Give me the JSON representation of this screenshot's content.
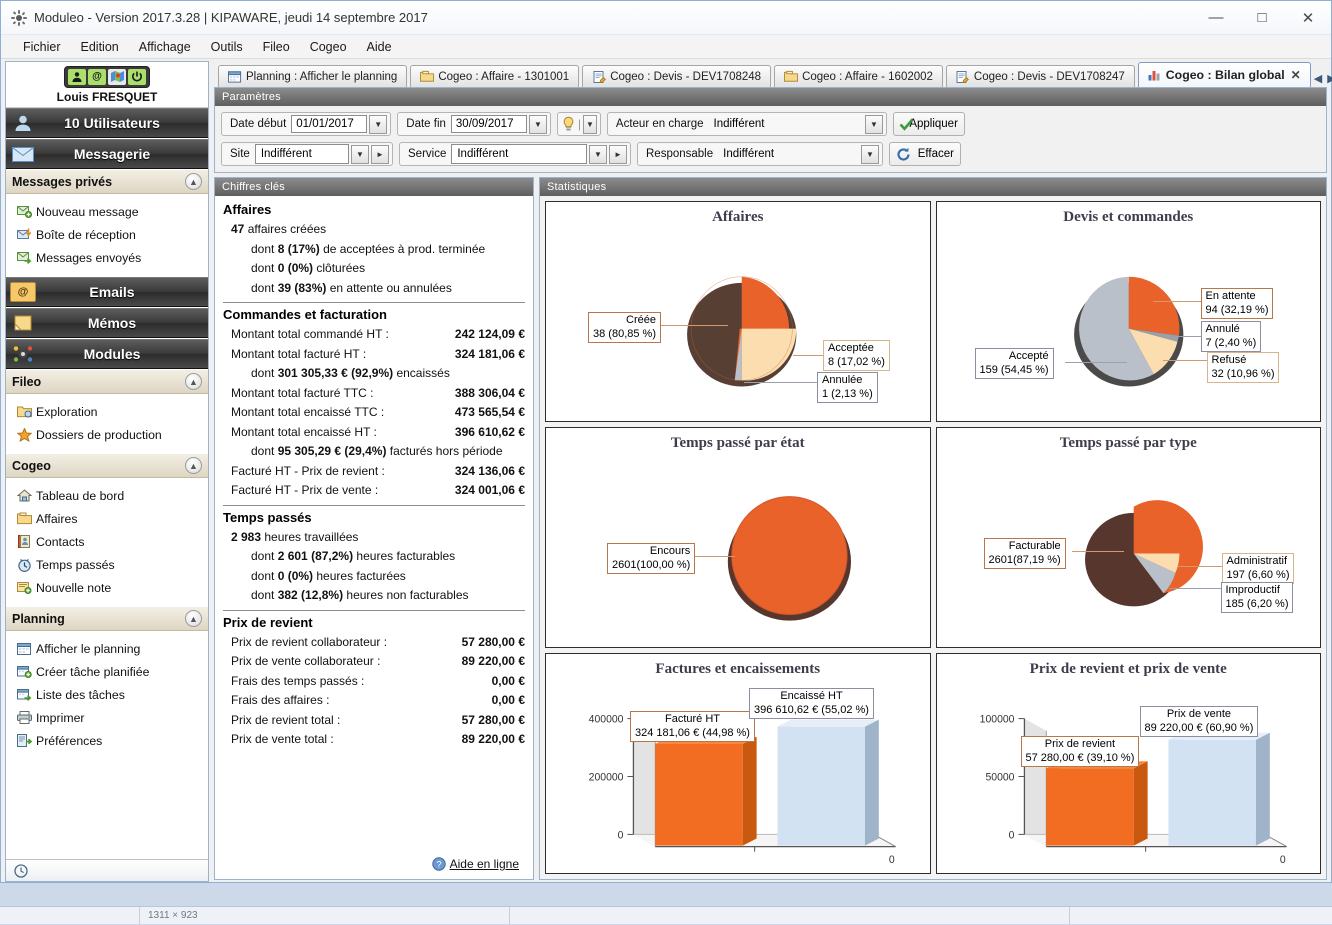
{
  "window": {
    "title": "Moduleo - Version 2017.3.28 | KIPAWARE, jeudi 14 septembre 2017",
    "minimize": "—",
    "maximize": "□",
    "close": "✕"
  },
  "menubar": [
    "Fichier",
    "Edition",
    "Affichage",
    "Outils",
    "Fileo",
    "Cogeo",
    "Aide"
  ],
  "sidebar": {
    "user_name": "Louis FRESQUET",
    "user_icons": [
      "person-icon",
      "at-icon",
      "map-icon",
      "power-icon"
    ],
    "sections": [
      {
        "label": "10 Utilisateurs",
        "icon": "users-icon"
      },
      {
        "label": "Messagerie",
        "icon": "envelope-icon"
      }
    ],
    "messages_group": {
      "label": "Messages privés",
      "items": [
        {
          "label": "Nouveau message",
          "icon": "new-mail-icon"
        },
        {
          "label": "Boîte de réception",
          "icon": "inbox-icon"
        },
        {
          "label": "Messages envoyés",
          "icon": "sent-mail-icon"
        }
      ]
    },
    "emails_label": "Emails",
    "memos_label": "Mémos",
    "modules_label": "Modules",
    "fileo_group": {
      "label": "Fileo",
      "items": [
        {
          "label": "Exploration",
          "icon": "folder-explore-icon"
        },
        {
          "label": "Dossiers de production",
          "icon": "star-icon"
        }
      ]
    },
    "cogeo_group": {
      "label": "Cogeo",
      "items": [
        {
          "label": "Tableau de bord",
          "icon": "home-icon"
        },
        {
          "label": "Affaires",
          "icon": "folder-icon"
        },
        {
          "label": "Contacts",
          "icon": "contacts-icon"
        },
        {
          "label": "Temps passés",
          "icon": "clock-icon"
        },
        {
          "label": "Nouvelle note",
          "icon": "note-add-icon"
        }
      ]
    },
    "planning_group": {
      "label": "Planning",
      "items": [
        {
          "label": "Afficher le planning",
          "icon": "calendar-icon"
        },
        {
          "label": "Créer tâche planifiée",
          "icon": "calendar-add-icon"
        },
        {
          "label": "Liste des tâches",
          "icon": "task-list-icon"
        },
        {
          "label": "Imprimer",
          "icon": "printer-icon"
        },
        {
          "label": "Préférences",
          "icon": "preferences-icon"
        }
      ]
    },
    "footer_icon": "clock-icon"
  },
  "tabs": [
    {
      "label": "Planning : Afficher le planning",
      "icon": "calendar-icon",
      "active": false
    },
    {
      "label": "Cogeo : Affaire - 1301001",
      "icon": "folder-icon",
      "active": false
    },
    {
      "label": "Cogeo : Devis - DEV1708248",
      "icon": "document-icon",
      "active": false
    },
    {
      "label": "Cogeo : Affaire - 1602002",
      "icon": "folder-icon",
      "active": false
    },
    {
      "label": "Cogeo : Devis - DEV1708247",
      "icon": "document-icon",
      "active": false
    },
    {
      "label": "Cogeo : Bilan global",
      "icon": "chart-icon",
      "active": true,
      "close": "✕"
    }
  ],
  "tab_nav": {
    "prev": "◀",
    "next": "▶",
    "list": "▼"
  },
  "params": {
    "header": "Paramètres",
    "date_debut_label": "Date début",
    "date_debut_value": "01/01/2017",
    "date_fin_label": "Date fin",
    "date_fin_value": "30/09/2017",
    "bulb_icon": "lightbulb-icon",
    "acteur_label": "Acteur en charge",
    "acteur_value": "Indifférent",
    "appliquer_label": "Appliquer",
    "site_label": "Site",
    "site_value": "Indifférent",
    "service_label": "Service",
    "service_value": "Indifférent",
    "responsable_label": "Responsable",
    "responsable_value": "Indifférent",
    "effacer_label": "Effacer"
  },
  "key_figures": {
    "header": "Chiffres clés",
    "help_link": "Aide en ligne",
    "groups": [
      {
        "title": "Affaires",
        "lines": [
          {
            "key": "47 affaires créées",
            "value": "",
            "sub": false,
            "bold_prefix": "47"
          },
          {
            "key": "dont 8 (17%) de  acceptées à prod. terminée",
            "value": "",
            "sub": true
          },
          {
            "key": "dont 0 (0%) clôturées",
            "value": "",
            "sub": true
          },
          {
            "key": "dont 39 (83%) en attente ou annulées",
            "value": "",
            "sub": true
          }
        ]
      },
      {
        "title": "Commandes et facturation",
        "lines": [
          {
            "key": "Montant total commandé HT :",
            "value": "242 124,09 €"
          },
          {
            "key": "Montant total facturé HT :",
            "value": "324 181,06 €"
          },
          {
            "key": "dont 301 305,33 € (92,9%) encaissés",
            "value": "",
            "sub": true
          },
          {
            "key": "Montant total facturé TTC :",
            "value": "388 306,04 €"
          },
          {
            "key": "Montant total encaissé TTC :",
            "value": "473 565,54 €"
          },
          {
            "key": "Montant total encaissé HT :",
            "value": "396 610,62 €"
          },
          {
            "key": "dont 95 305,29 € (29,4%) facturés hors période",
            "value": "",
            "sub": true
          },
          {
            "key": "Facturé HT - Prix de revient :",
            "value": "324 136,06 €"
          },
          {
            "key": "Facturé HT - Prix de vente :",
            "value": "324 001,06 €"
          }
        ]
      },
      {
        "title": "Temps passés",
        "lines": [
          {
            "key": "2 983 heures travaillées",
            "value": ""
          },
          {
            "key": "dont 2 601 (87,2%) heures facturables",
            "value": "",
            "sub": true
          },
          {
            "key": "dont 0 (0%) heures facturées",
            "value": "",
            "sub": true
          },
          {
            "key": "dont 382 (12,8%) heures non facturables",
            "value": "",
            "sub": true
          }
        ]
      },
      {
        "title": "Prix de revient",
        "lines": [
          {
            "key": "Prix de revient collaborateur :",
            "value": "57 280,00 €"
          },
          {
            "key": "Prix de vente collaborateur :",
            "value": "89 220,00 €"
          },
          {
            "key": "Frais des temps passés :",
            "value": "0,00 €"
          },
          {
            "key": "Frais des affaires :",
            "value": "0,00 €"
          },
          {
            "key": "Prix de revient total :",
            "value": "57 280,00 €"
          },
          {
            "key": "Prix de vente total :",
            "value": "89 220,00 €"
          }
        ]
      }
    ]
  },
  "statistics": {
    "header": "Statistiques"
  },
  "colors": {
    "orange": "#e8622a",
    "orange_light": "#ea7650",
    "tan": "#fbddb0",
    "gray": "#b9c0c9",
    "blue_light": "#d3e2f2"
  },
  "chart_data": [
    {
      "type": "pie",
      "title": "Affaires",
      "labels": [
        "Créée",
        "Acceptée",
        "Annulée"
      ],
      "values": [
        38,
        8,
        1
      ],
      "percents": [
        "80,85 %",
        "17,02 %",
        "2,13 %"
      ],
      "value_labels": [
        "38 (80,85 %)",
        "8 (17,02 %)",
        "1 (2,13 %)"
      ],
      "colors": [
        "#e8622a",
        "#fbddb0",
        "#b9c0c9"
      ],
      "legend": "callouts"
    },
    {
      "type": "pie",
      "title": "Devis et commandes",
      "labels": [
        "En attente",
        "Annulé",
        "Refusé",
        "Accepté"
      ],
      "values": [
        94,
        7,
        32,
        159
      ],
      "percents": [
        "32,19 %",
        "2,40 %",
        "10,96 %",
        "54,45 %"
      ],
      "value_labels": [
        "94 (32,19 %)",
        "7 (2,40 %)",
        "32 (10,96 %)",
        "159 (54,45 %)"
      ],
      "colors": [
        "#e8622a",
        "#9aa0ab",
        "#fbddb0",
        "#b9c0c9"
      ],
      "legend": "callouts"
    },
    {
      "type": "pie",
      "title": "Temps passé par état",
      "labels": [
        "Encours"
      ],
      "values": [
        2601
      ],
      "percents": [
        "100,00 %"
      ],
      "value_labels": [
        "2601(100,00 %)"
      ],
      "colors": [
        "#e8622a"
      ],
      "legend": "callouts"
    },
    {
      "type": "pie",
      "title": "Temps passé par type",
      "labels": [
        "Facturable",
        "Administratif",
        "Improductif"
      ],
      "values": [
        2601,
        197,
        185
      ],
      "percents": [
        "87,19 %",
        "6,60 %",
        "6,20 %"
      ],
      "value_labels": [
        "2601(87,19 %)",
        "197 (6,60 %)",
        "185 (6,20 %)"
      ],
      "colors": [
        "#e8622a",
        "#fbddb0",
        "#b9c0c9"
      ],
      "legend": "callouts"
    },
    {
      "type": "bar",
      "title": "Factures et encaissements",
      "categories": [
        "Facturé HT",
        "Encaissé HT"
      ],
      "values": [
        324181.06,
        396610.62
      ],
      "value_labels": [
        "324 181,06 € (44,98 %)",
        "396 610,62 € (55,02 %)"
      ],
      "percents": [
        "44,98 %",
        "55,02 %"
      ],
      "yticks": [
        "0",
        "200000",
        "400000"
      ],
      "ylim": [
        0,
        400000
      ],
      "xaxis_right_label": "0",
      "colors": [
        "#f26c21",
        "#d3e2f2"
      ]
    },
    {
      "type": "bar",
      "title": "Prix de revient et prix de vente",
      "categories": [
        "Prix de revient",
        "Prix de vente"
      ],
      "values": [
        57280.0,
        89220.0
      ],
      "value_labels": [
        "57 280,00 € (39,10 %)",
        "89 220,00 € (60,90 %)"
      ],
      "percents": [
        "39,10 %",
        "60,90 %"
      ],
      "yticks": [
        "0",
        "50000",
        "100000"
      ],
      "ylim": [
        0,
        100000
      ],
      "xaxis_right_label": "0",
      "colors": [
        "#f26c21",
        "#d3e2f2"
      ]
    }
  ],
  "taskbar": {
    "cell1": "",
    "cell2": "1311 × 923"
  }
}
